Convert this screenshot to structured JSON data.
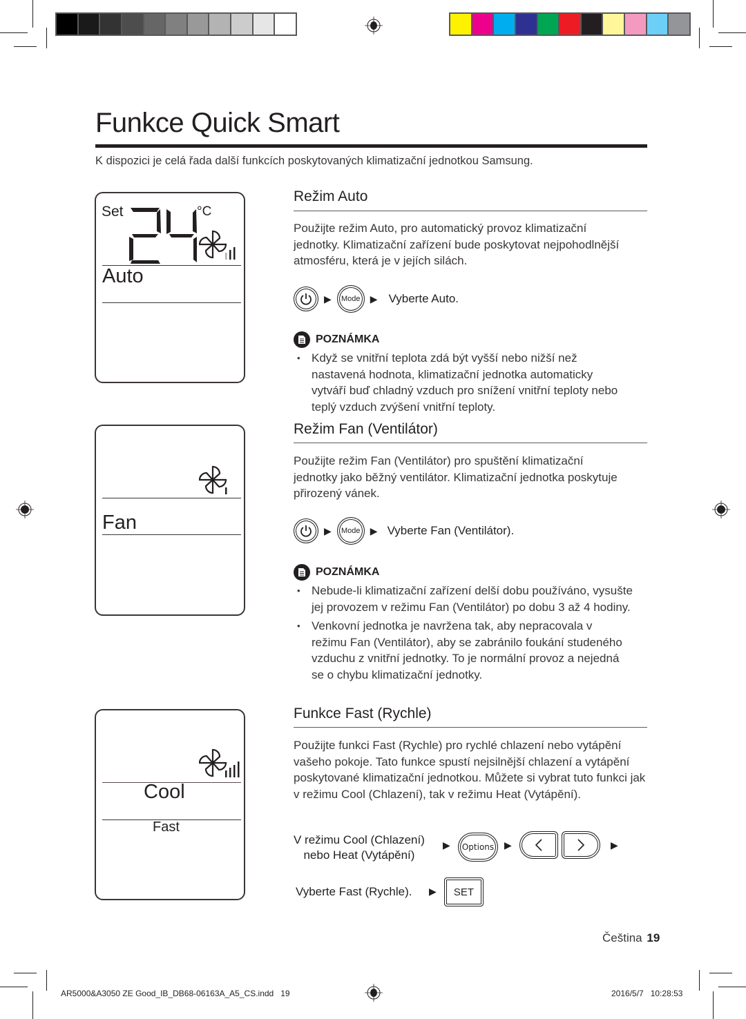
{
  "print_marks": {
    "grayscale_swatches": [
      "#000000",
      "#1a1a1a",
      "#333333",
      "#4d4d4d",
      "#666666",
      "#808080",
      "#999999",
      "#b3b3b3",
      "#cccccc",
      "#e6e6e6",
      "#ffffff"
    ],
    "color_swatches": [
      "#fff200",
      "#ec008c",
      "#00aeef",
      "#2e3192",
      "#00a651",
      "#ed1c24",
      "#231f20",
      "#fff799",
      "#f49ac1",
      "#6dcff6",
      "#939598"
    ]
  },
  "page": {
    "title": "Funkce Quick Smart",
    "intro": "K dispozici je celá řada další funkcích poskytovaných klimatizační jednotkou Samsung."
  },
  "displays": {
    "auto": {
      "set_label": "Set",
      "temperature": "24",
      "unit": "°C",
      "mode": "Auto",
      "fan_level": 2
    },
    "fan": {
      "mode": "Fan",
      "fan_level": 1
    },
    "fast": {
      "mode": "Cool",
      "function": "Fast",
      "fan_level": 4
    }
  },
  "sections": {
    "auto": {
      "heading": "Režim Auto",
      "paragraph": "Použijte režim Auto, pro automatický provoz klimatizační jednotky. Klimatizační zařízení bude poskytovat nejpohodlnější atmosféru, která je v jejích silách.",
      "steps": {
        "mode_button": "Mode",
        "result": "Vyberte Auto."
      },
      "note_label": "POZNÁMKA",
      "notes": [
        "Když se vnitřní teplota zdá být vyšší nebo nižší než nastavená hodnota, klimatizační jednotka automaticky vytváří buď chladný vzduch pro snížení vnitřní teploty nebo teplý vzduch zvýšení vnitřní teploty."
      ]
    },
    "fan": {
      "heading": "Režim Fan (Ventilátor)",
      "paragraph": "Použijte režim Fan (Ventilátor) pro spuštění klimatizační jednotky jako běžný ventilátor. Klimatizační jednotka poskytuje přirozený vánek.",
      "steps": {
        "mode_button": "Mode",
        "result": "Vyberte Fan (Ventilátor)."
      },
      "note_label": "POZNÁMKA",
      "notes": [
        "Nebude-li klimatizační zařízení delší dobu používáno, vysušte jej provozem v režimu Fan (Ventilátor) po dobu 3 až 4 hodiny.",
        "Venkovní jednotka je navržena tak, aby nepracovala v režimu Fan (Ventilátor), aby se zabránilo foukání studeného vzduchu z vnitřní jednotky. To je normální provoz a nejedná se o chybu klimatizační jednotky."
      ]
    },
    "fast": {
      "heading": "Funkce Fast (Rychle)",
      "paragraph": "Použijte funkci Fast (Rychle) pro rychlé chlazení nebo vytápění vašeho pokoje. Tato funkce spustí nejsilnější chlazení a vytápění poskytované klimatizační jednotkou. Můžete si vybrat tuto funkci jak v režimu Cool (Chlazení), tak v režimu Heat (Vytápění).",
      "steps": {
        "condition_line1": "V režimu Cool (Chlazení)",
        "condition_line2": "nebo Heat (Vytápění)",
        "options_button": "Options",
        "select_text": "Vyberte Fast (Rychle).",
        "set_button": "SET"
      }
    }
  },
  "footer": {
    "language": "Čeština",
    "page_number": "19",
    "file_info": "AR5000&A3050 ZE Good_IB_DB68-06163A_A5_CS.indd   19",
    "timestamp": "2016/5/7   10:28:53"
  }
}
